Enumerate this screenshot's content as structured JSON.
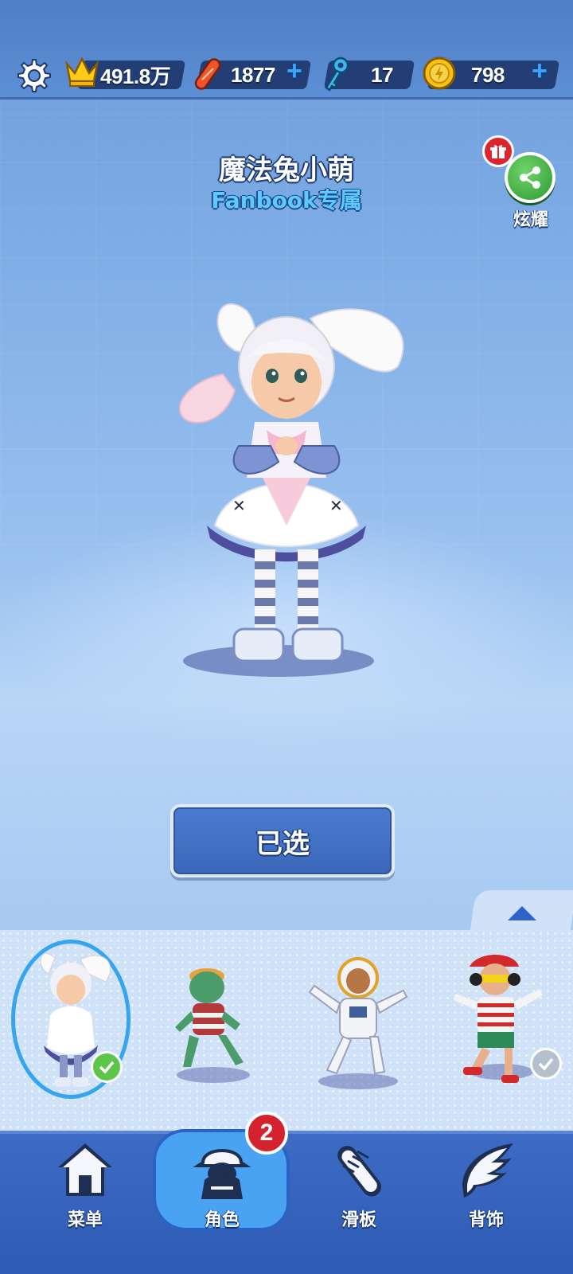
{
  "topbar": {
    "score": "491.8万",
    "boards": "1877",
    "keys": "17",
    "coins": "798"
  },
  "character": {
    "name": "魔法兔小萌",
    "subtitle": "Fanbook专属"
  },
  "share": {
    "label": "炫耀"
  },
  "select_button": {
    "label": "已选"
  },
  "carousel": {
    "characters": [
      {
        "icon": "bunny-girl-character",
        "selected": true,
        "owned": true
      },
      {
        "icon": "green-creature-character",
        "selected": false,
        "owned": false
      },
      {
        "icon": "astronaut-character",
        "selected": false,
        "owned": false
      },
      {
        "icon": "headphones-boy-character",
        "selected": false,
        "owned": true
      }
    ]
  },
  "nav": {
    "badge_count": "2",
    "items": [
      {
        "label": "菜单",
        "icon": "home-icon"
      },
      {
        "label": "角色",
        "icon": "character-icon"
      },
      {
        "label": "滑板",
        "icon": "skateboard-icon"
      },
      {
        "label": "背饰",
        "icon": "wing-icon"
      }
    ]
  },
  "colors": {
    "accent_blue": "#3c67b8",
    "plus_blue": "#3aa6ff",
    "share_green": "#2d9b33",
    "badge_red": "#d4232e"
  }
}
